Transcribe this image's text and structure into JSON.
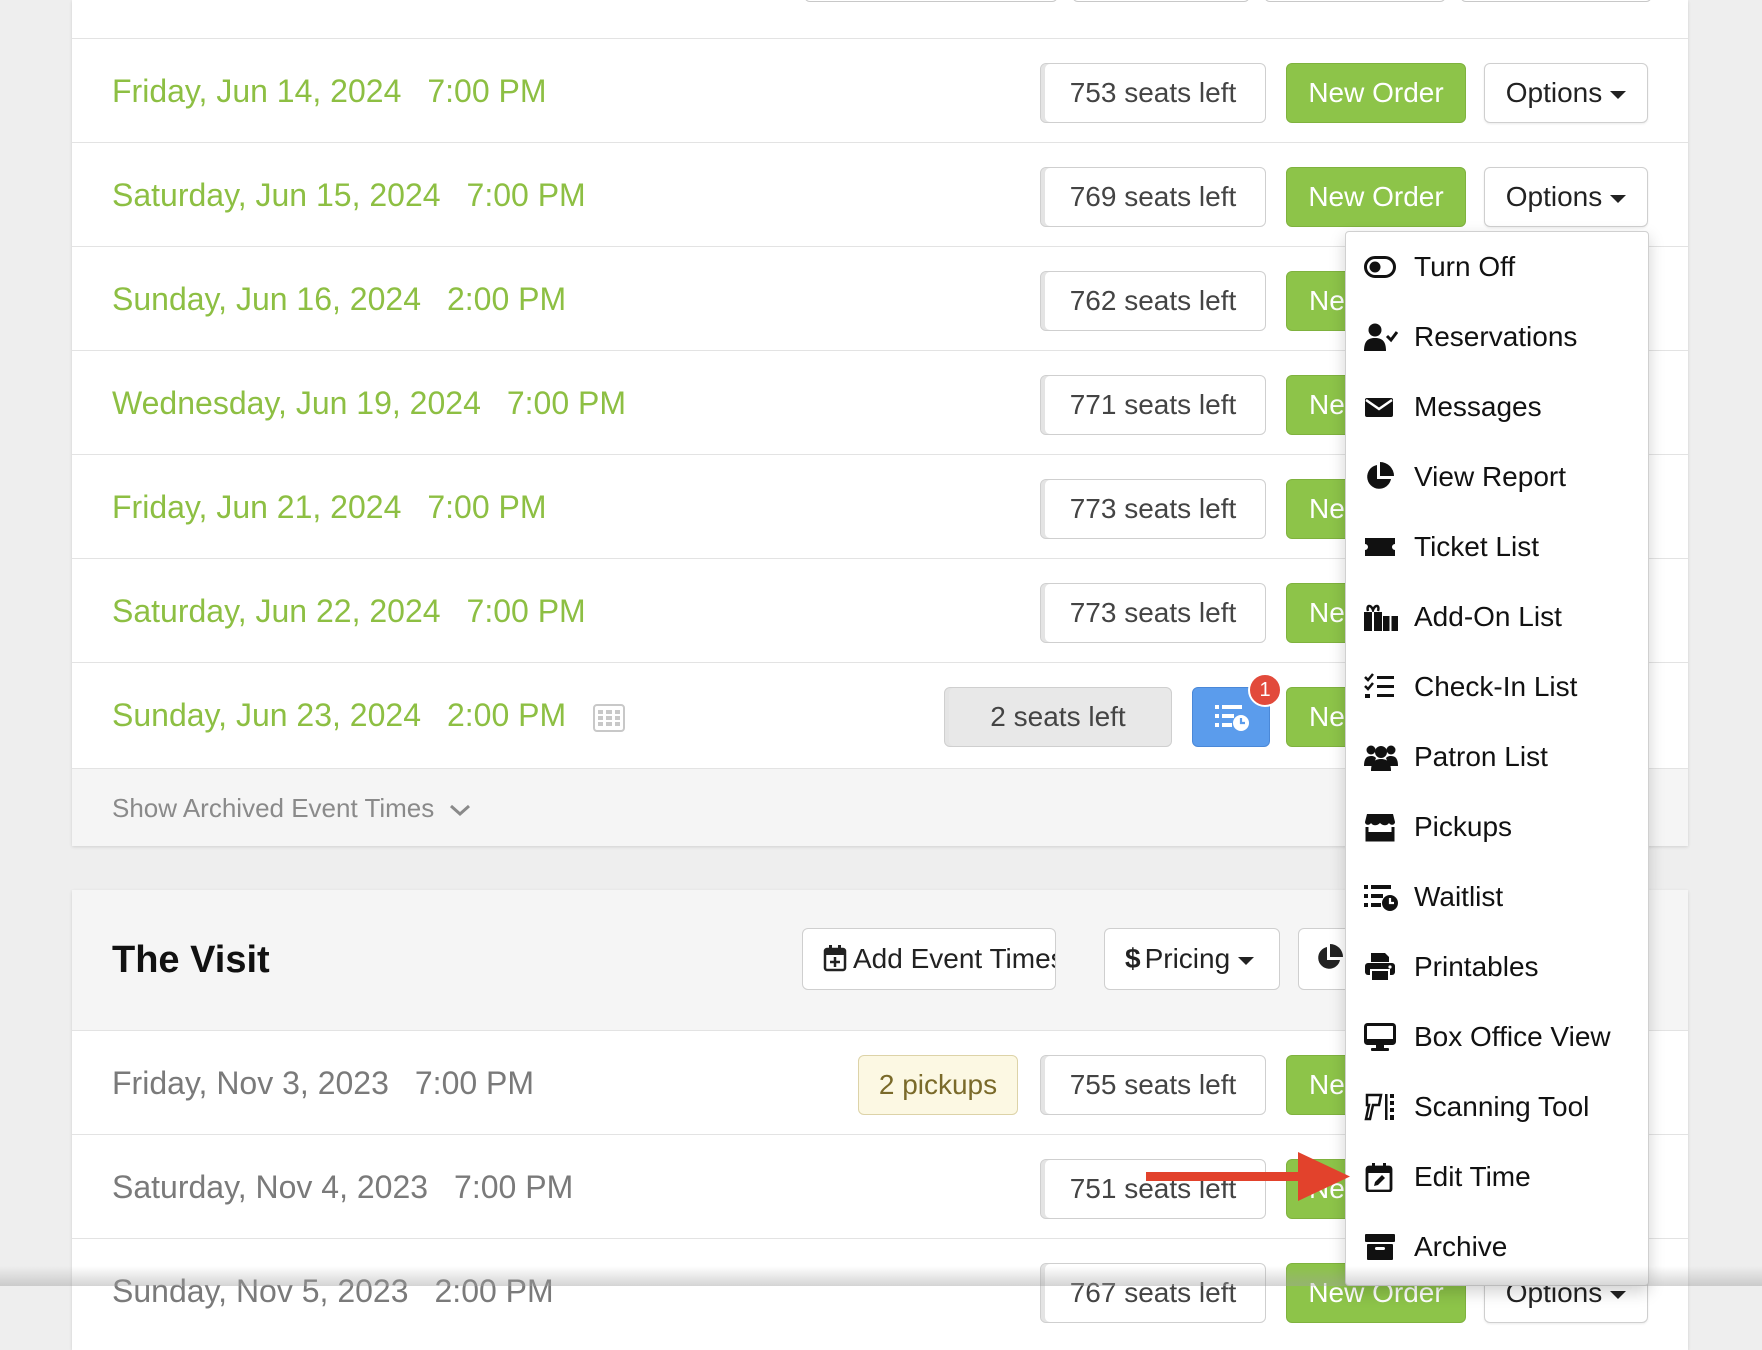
{
  "upper_event": {
    "rows": [
      {
        "date": "Friday, Jun 14, 2024",
        "time": "7:00 PM",
        "seats": "753 seats left",
        "order_label": "New Order",
        "options_label": "Options"
      },
      {
        "date": "Saturday, Jun 15, 2024",
        "time": "7:00 PM",
        "seats": "769 seats left",
        "order_label": "New Order",
        "options_label": "Options"
      },
      {
        "date": "Sunday, Jun 16, 2024",
        "time": "2:00 PM",
        "seats": "762 seats left",
        "order_label": "Ne"
      },
      {
        "date": "Wednesday, Jun 19, 2024",
        "time": "7:00 PM",
        "seats": "771 seats left",
        "order_label": "Ne"
      },
      {
        "date": "Friday, Jun 21, 2024",
        "time": "7:00 PM",
        "seats": "773 seats left",
        "order_label": "Ne"
      },
      {
        "date": "Saturday, Jun 22, 2024",
        "time": "7:00 PM",
        "seats": "773 seats left",
        "order_label": "Ne"
      },
      {
        "date": "Sunday, Jun 23, 2024",
        "time": "2:00 PM",
        "seats": "2 seats left",
        "order_label": "Ne",
        "waitlist_badge": "1"
      }
    ],
    "show_archived": "Show Archived Event Times"
  },
  "visit_event": {
    "title": "The Visit",
    "add_times_label": "Add Event Times",
    "pricing_label": "Pricing",
    "pricing_symbol": "$",
    "rows": [
      {
        "date": "Friday, Nov 3, 2023",
        "time": "7:00 PM",
        "pickups": "2 pickups",
        "seats": "755 seats left",
        "order_label": "Ne"
      },
      {
        "date": "Saturday, Nov 4, 2023",
        "time": "7:00 PM",
        "seats": "751 seats left",
        "order_label": "Ne"
      },
      {
        "date": "Sunday, Nov 5, 2023",
        "time": "2:00 PM",
        "seats": "767 seats left",
        "order_label": "New Order",
        "options_label": "Options"
      }
    ]
  },
  "options_menu": {
    "items": [
      {
        "label": "Turn Off",
        "icon": "toggle-icon"
      },
      {
        "label": "Reservations",
        "icon": "user-check-icon"
      },
      {
        "label": "Messages",
        "icon": "envelope-icon"
      },
      {
        "label": "View Report",
        "icon": "pie-chart-icon"
      },
      {
        "label": "Ticket List",
        "icon": "ticket-icon"
      },
      {
        "label": "Add-On List",
        "icon": "gifts-icon"
      },
      {
        "label": "Check-In List",
        "icon": "checklist-icon"
      },
      {
        "label": "Patron List",
        "icon": "users-icon"
      },
      {
        "label": "Pickups",
        "icon": "store-icon"
      },
      {
        "label": "Waitlist",
        "icon": "list-clock-icon"
      },
      {
        "label": "Printables",
        "icon": "printer-icon"
      },
      {
        "label": "Box Office View",
        "icon": "monitor-icon"
      },
      {
        "label": "Scanning Tool",
        "icon": "scanner-icon"
      },
      {
        "label": "Edit Time",
        "icon": "calendar-edit-icon"
      },
      {
        "label": "Archive",
        "icon": "archive-box-icon"
      }
    ]
  },
  "colors": {
    "date_green": "#8dbf43",
    "button_green": "#8dc449",
    "waitlist_blue": "#5b9cec",
    "badge_red": "#e24a3b",
    "arrow_red": "#e2422c"
  }
}
